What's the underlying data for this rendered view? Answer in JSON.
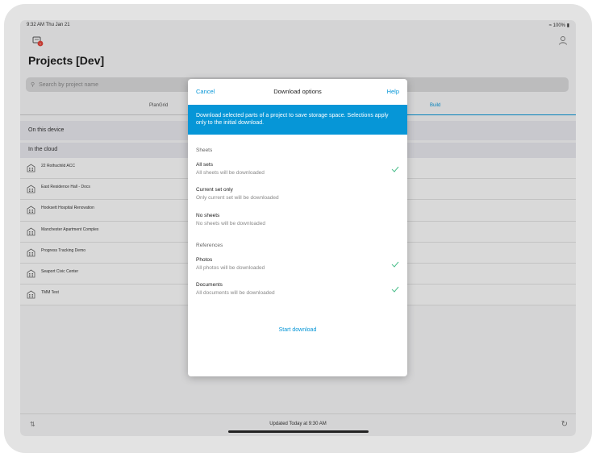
{
  "status_bar": {
    "time": "9:32 AM  Thu Jan 21",
    "battery": "100%"
  },
  "page": {
    "title": "Projects [Dev]"
  },
  "search": {
    "placeholder": "Search by project name"
  },
  "tabs": [
    {
      "label": "PlanGrid"
    },
    {
      "label": "Build"
    }
  ],
  "sections": {
    "on_device": "On this device",
    "in_cloud": "In the cloud"
  },
  "projects": [
    {
      "name": "22 Rothschild ACC"
    },
    {
      "name": "East Residence Hall - Docs"
    },
    {
      "name": "Hooksett Hospital Renovation"
    },
    {
      "name": "Manchester Apartment Complex"
    },
    {
      "name": "Progress Tracking Demo"
    },
    {
      "name": "Seaport Civic Center"
    },
    {
      "name": "TMM Test"
    }
  ],
  "footer": {
    "updated": "Updated Today at 9:30 AM"
  },
  "modal": {
    "cancel": "Cancel",
    "title": "Download options",
    "help": "Help",
    "banner": "Download selected parts of a project to save storage space. Selections apply only to the initial download.",
    "sheets_label": "Sheets",
    "sheet_options": [
      {
        "title": "All sets",
        "subtitle": "All sheets will be downloaded",
        "checked": true
      },
      {
        "title": "Current set only",
        "subtitle": "Only current set will be downloaded",
        "checked": false
      },
      {
        "title": "No sheets",
        "subtitle": "No sheets will be downloaded",
        "checked": false
      }
    ],
    "references_label": "References",
    "reference_options": [
      {
        "title": "Photos",
        "subtitle": "All photos will be downloaded",
        "checked": true
      },
      {
        "title": "Documents",
        "subtitle": "All documents will be downloaded",
        "checked": true
      }
    ],
    "start_button": "Start download"
  },
  "colors": {
    "accent": "#0696d7",
    "check": "#4dbf8c"
  }
}
